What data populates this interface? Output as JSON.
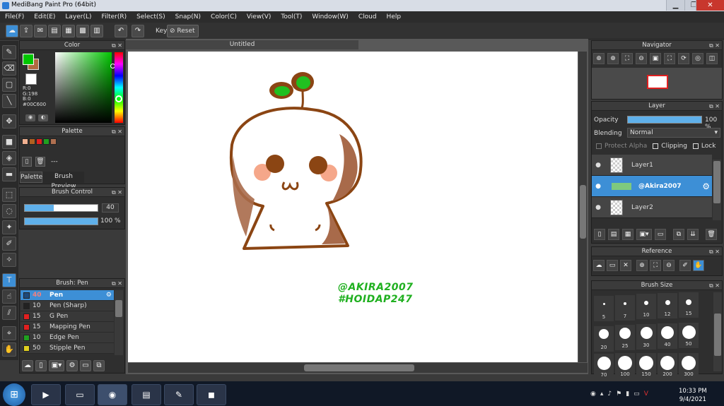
{
  "window": {
    "title": "MediBang Paint Pro (64bit)"
  },
  "menu": [
    "File(F)",
    "Edit(E)",
    "Layer(L)",
    "Filter(R)",
    "Select(S)",
    "Snap(N)",
    "Color(C)",
    "View(V)",
    "Tool(T)",
    "Window(W)",
    "Cloud",
    "Help"
  ],
  "toolbar": {
    "key_label": "Key",
    "reset_label": "Reset"
  },
  "color_panel": {
    "title": "Color",
    "r": "R:0",
    "g": "G:198",
    "b": "B:0",
    "hex": "#00C600",
    "main_color": "#00c600",
    "sub_color": "#ffffff"
  },
  "palette_panel": {
    "title": "Palette",
    "swatches": [
      "#f0b090",
      "#b06020",
      "#e02020",
      "#20a020",
      "#b07050"
    ],
    "none_label": "---",
    "tab_palette": "Palette",
    "tab_preview": "Brush Preview"
  },
  "brush_control": {
    "title": "Brush Control",
    "size_value": "40",
    "opacity_value": "100 %",
    "size_fraction": 0.4,
    "opacity_fraction": 1.0
  },
  "brush_panel": {
    "title": "Brush: Pen",
    "items": [
      {
        "size": "40",
        "name": "Pen",
        "color": "#3d8fd6",
        "selected": true
      },
      {
        "size": "10",
        "name": "Pen (Sharp)",
        "color": "#222222"
      },
      {
        "size": "15",
        "name": "G Pen",
        "color": "#e02020"
      },
      {
        "size": "15",
        "name": "Mapping Pen",
        "color": "#e02020"
      },
      {
        "size": "10",
        "name": "Edge Pen",
        "color": "#20a020"
      },
      {
        "size": "50",
        "name": "Stipple Pen",
        "color": "#e0d020"
      }
    ]
  },
  "document": {
    "tab": "Untitled",
    "watermark_line1": "@AKIRA2007",
    "watermark_line2": "#HOIDAP247"
  },
  "navigator": {
    "title": "Navigator"
  },
  "layer_panel": {
    "title": "Layer",
    "opacity_label": "Opacity",
    "opacity_value": "100 %",
    "blending_label": "Blending",
    "blending_value": "Normal",
    "protect_alpha": "Protect Alpha",
    "clipping": "Clipping",
    "lock": "Lock",
    "layers": [
      {
        "name": "Layer1"
      },
      {
        "name": "@Akira2007",
        "selected": true
      },
      {
        "name": "Layer2"
      }
    ]
  },
  "reference_panel": {
    "title": "Reference"
  },
  "brush_size_panel": {
    "title": "Brush Size",
    "sizes": [
      "5",
      "7",
      "10",
      "12",
      "15",
      "20",
      "25",
      "30",
      "40",
      "50",
      "70",
      "100",
      "150",
      "200",
      "300"
    ]
  },
  "clock": {
    "time": "10:33 PM",
    "date": "9/4/2021"
  }
}
